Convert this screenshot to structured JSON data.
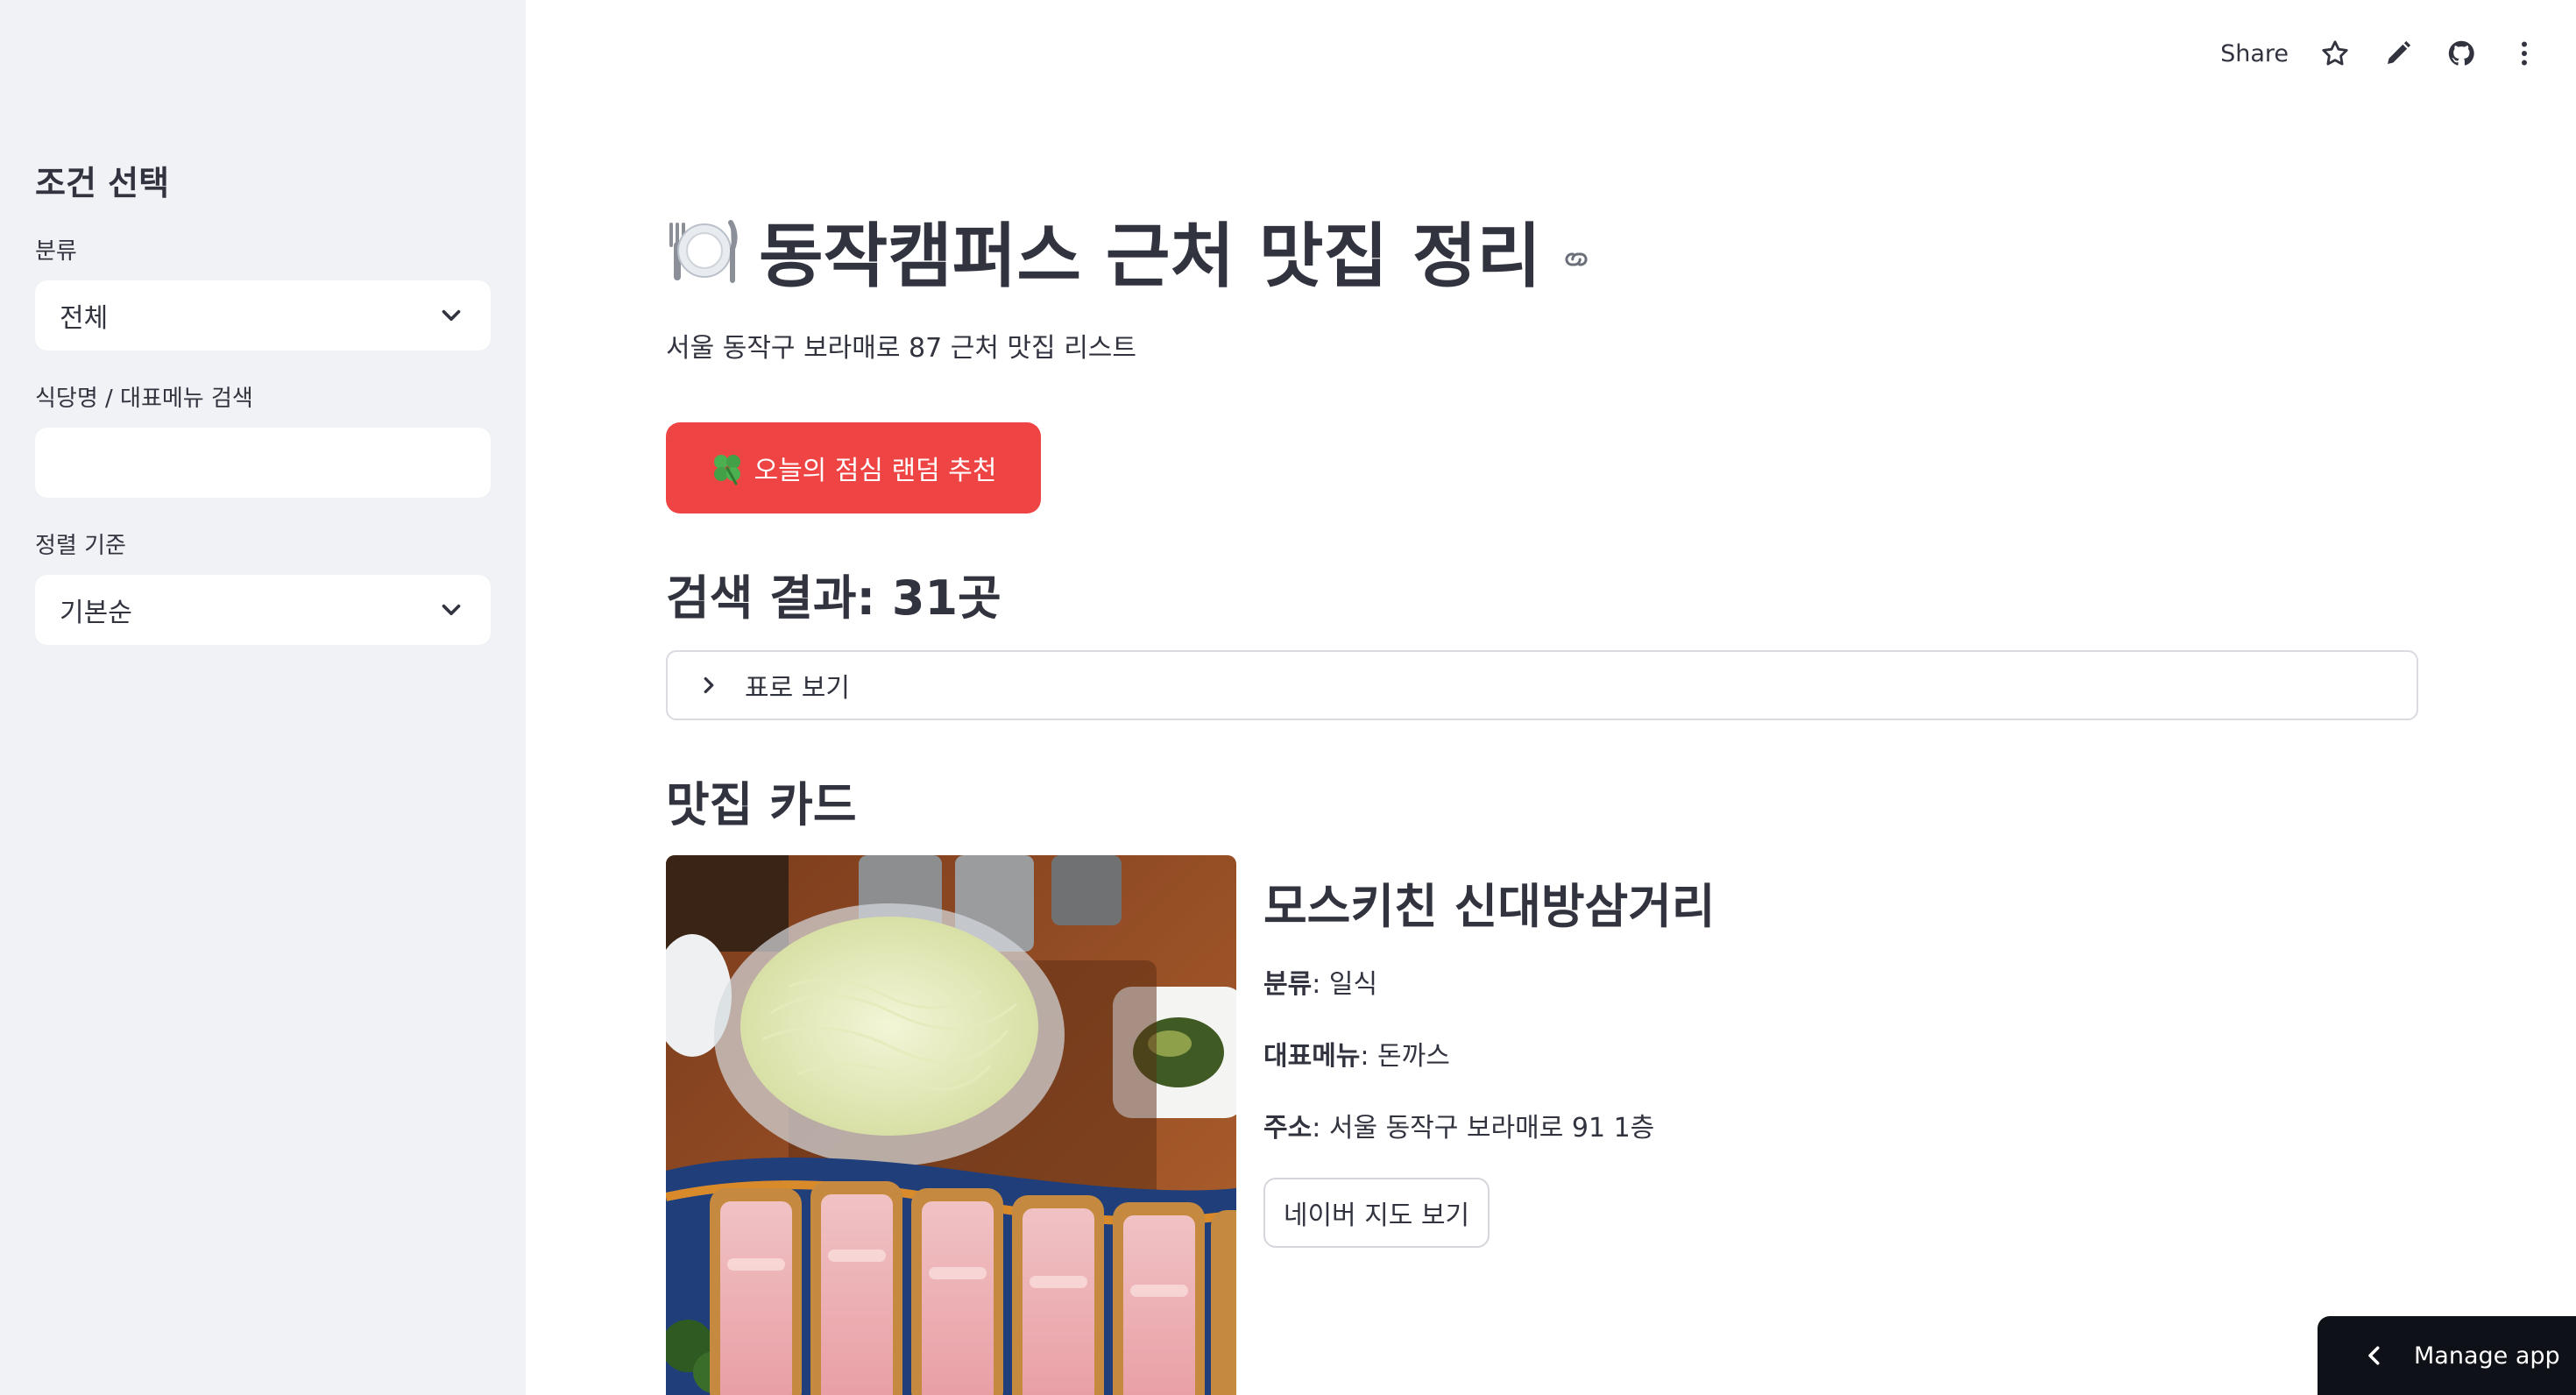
{
  "sidebar": {
    "title": "조건 선택",
    "category_label": "분류",
    "category_value": "전체",
    "search_label": "식당명 / 대표메뉴 검색",
    "search_value": "",
    "sort_label": "정렬 기준",
    "sort_value": "기본순"
  },
  "toolbar": {
    "share_label": "Share",
    "icons": [
      "star-icon",
      "pencil-icon",
      "github-icon",
      "more-vertical-icon"
    ]
  },
  "main": {
    "title": "동작캠퍼스 근처 맛집 정리",
    "title_icon": "plate-cutlery-icon",
    "subtitle": "서울 동작구 보라매로 87 근처 맛집 리스트",
    "random_button_label": "오늘의 점심 랜덤 추천",
    "random_button_icon": "four-leaf-clover-icon",
    "results_heading": "검색 결과: 31곳",
    "expander_label": "표로 보기",
    "cards_heading": "맛집 카드"
  },
  "card": {
    "name": "모스키친 신대방삼거리",
    "category_key": "분류",
    "category_value": ": 일식",
    "menu_key": "대표메뉴",
    "menu_value": ": 돈까스",
    "address_key": "주소",
    "address_value": ": 서울 동작구 보라매로 91 1층",
    "map_button_label": "네이버 지도 보기",
    "photo_description_icon": "tonkatsu-photo"
  },
  "manage_app": {
    "label": "Manage app"
  },
  "colors": {
    "sidebar_bg": "#f0f2f6",
    "primary_button": "#ef4444",
    "text": "#31333f",
    "manage_app_bg": "#0e1117"
  }
}
